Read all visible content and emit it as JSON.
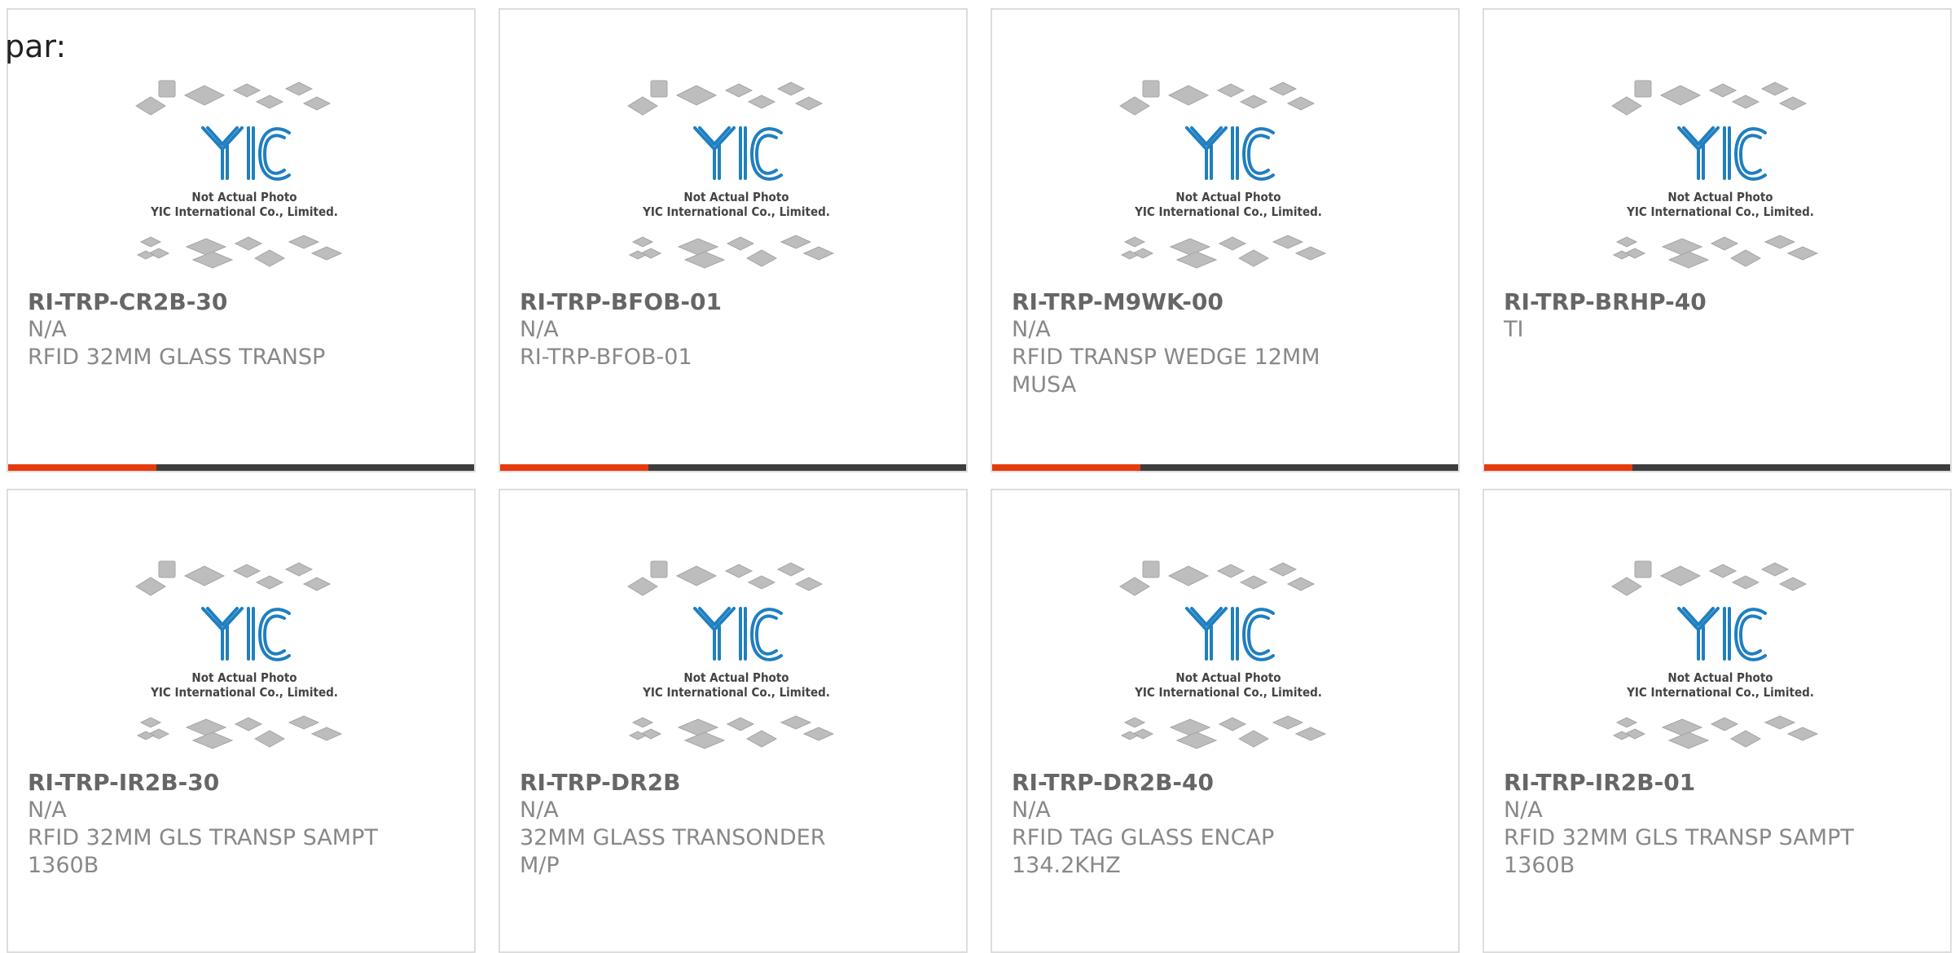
{
  "header": {
    "label": "par:"
  },
  "brand": {
    "logo_text": "YIC",
    "photo_note": "Not Actual Photo",
    "company": "YIC International Co., Limited."
  },
  "colors": {
    "accent": "#e53a0e",
    "bar_dark": "#3d3d3d",
    "logo_blue": "#1f7fc0"
  },
  "products": [
    {
      "part": "RI-TRP-CR2B-30",
      "manufacturer": "N/A",
      "description": "RFID 32MM GLASS TRANSP",
      "has_bar": true
    },
    {
      "part": "RI-TRP-BFOB-01",
      "manufacturer": "N/A",
      "description": "RI-TRP-BFOB-01",
      "has_bar": true
    },
    {
      "part": "RI-TRP-M9WK-00",
      "manufacturer": "N/A",
      "description": "RFID TRANSP WEDGE 12MM MUSA",
      "has_bar": true
    },
    {
      "part": "RI-TRP-BRHP-40",
      "manufacturer": "TI",
      "description": "",
      "has_bar": true
    },
    {
      "part": "RI-TRP-IR2B-30",
      "manufacturer": "N/A",
      "description": "RFID 32MM GLS TRANSP SAMPT 1360B",
      "has_bar": false
    },
    {
      "part": "RI-TRP-DR2B",
      "manufacturer": "N/A",
      "description": "32MM GLASS TRANSONDER M/P",
      "has_bar": false
    },
    {
      "part": "RI-TRP-DR2B-40",
      "manufacturer": "N/A",
      "description": "RFID TAG GLASS ENCAP 134.2KHZ",
      "has_bar": false
    },
    {
      "part": "RI-TRP-IR2B-01",
      "manufacturer": "N/A",
      "description": "RFID 32MM GLS TRANSP SAMPT 1360B",
      "has_bar": false
    }
  ]
}
